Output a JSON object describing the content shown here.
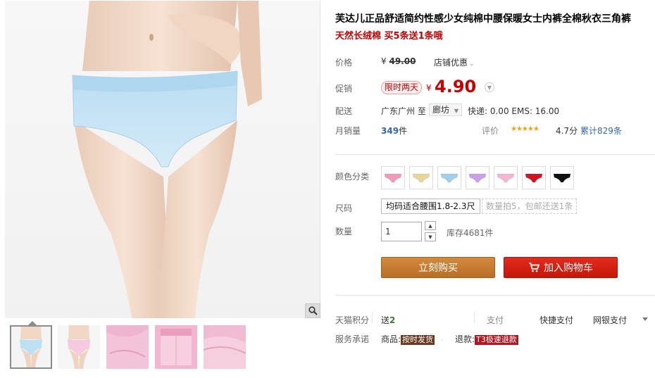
{
  "product": {
    "title": "芙达儿正品舒适简约性感少女纯棉中腰保暖女士内裤全棉秋衣三角裤",
    "subtitle": "天然长绒棉 买5条送1条哦"
  },
  "price": {
    "label": "价格",
    "currency": "¥",
    "original": "49.00",
    "store_discount": "店铺优惠"
  },
  "promo": {
    "label": "促销",
    "tag": "限时两天",
    "currency": "¥",
    "price": "4.90"
  },
  "shipping": {
    "label": "配送",
    "origin": "广东广州",
    "to": "至",
    "destination": "廊坊",
    "fees": "快递: 0.00 EMS: 16.00"
  },
  "sales": {
    "label": "月销量",
    "count": "349",
    "unit": "件",
    "rating_label": "评价",
    "stars": "★★★★★",
    "rating": "4.7分",
    "reviews": "累计829条"
  },
  "color": {
    "label": "颜色分类",
    "swatches": [
      {
        "name": "pink",
        "hex": "#f29bb8"
      },
      {
        "name": "beige",
        "hex": "#e8d59e"
      },
      {
        "name": "light-blue",
        "hex": "#9fd0ec"
      },
      {
        "name": "lavender",
        "hex": "#c6a2e6"
      },
      {
        "name": "light-pink",
        "hex": "#f3b6d3"
      },
      {
        "name": "red",
        "hex": "#d4141f"
      },
      {
        "name": "black",
        "hex": "#111111"
      }
    ]
  },
  "size": {
    "label": "尺码",
    "option": "均码适合腰围1.8-2.3尺",
    "hint": "数量拍5，包邮还送1条"
  },
  "quantity": {
    "label": "数量",
    "value": "1",
    "stock": "库存4681件"
  },
  "actions": {
    "buy_now": "立刻购买",
    "add_to_cart": "加入购物车"
  },
  "points": {
    "label": "天猫积分",
    "send": "送",
    "amount": "2"
  },
  "payment": {
    "label": "支付",
    "methods": [
      "快捷支付",
      "网银支付"
    ]
  },
  "service": {
    "label": "服务承诺",
    "goods_label": "商品:",
    "goods_badge": "按时发货",
    "refund_label": "退款:",
    "refund_badge": "T3极速退款"
  },
  "colors": {
    "accent_red": "#c40000",
    "buy_button": "#c9802f",
    "cart_button": "#d92314",
    "garment_blue": "#c9e4f4"
  }
}
